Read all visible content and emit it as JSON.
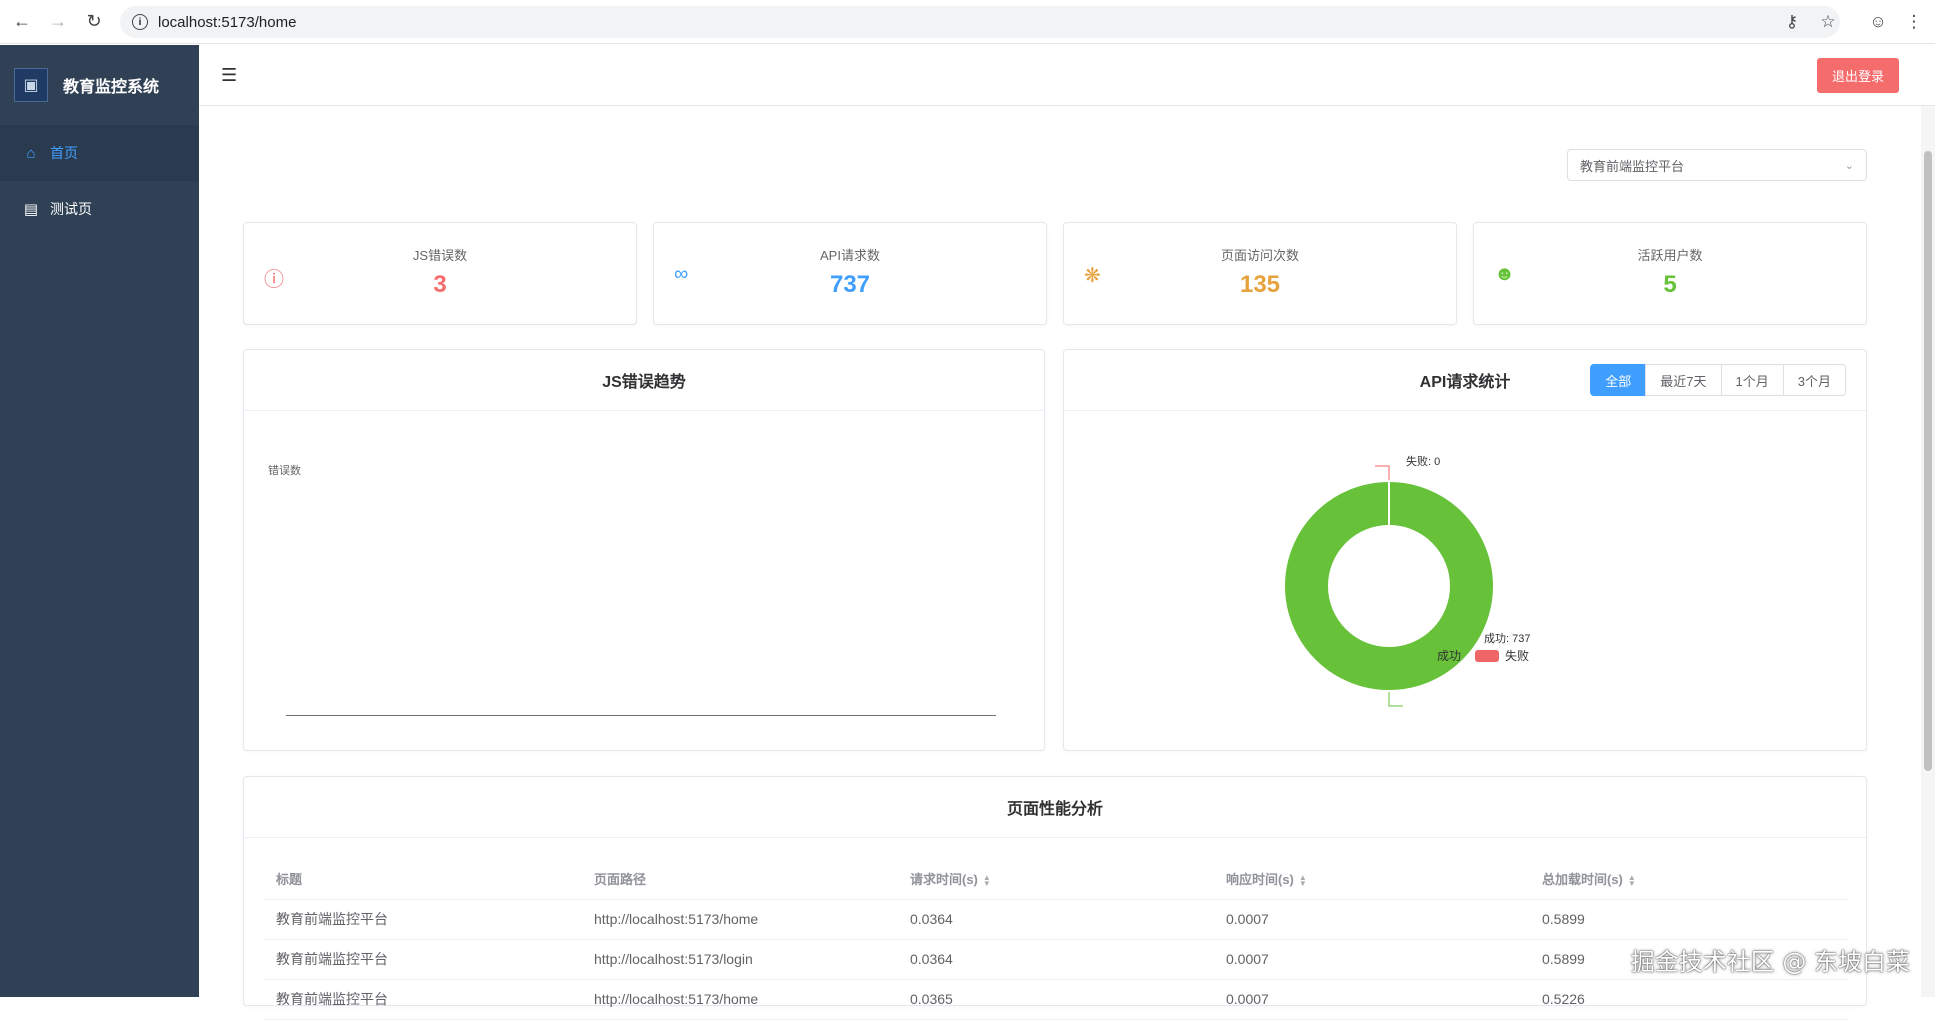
{
  "browser": {
    "url": "localhost:5173/home"
  },
  "sidebar": {
    "title": "教育监控系统",
    "items": [
      {
        "label": "首页",
        "icon": "home-icon",
        "active": true
      },
      {
        "label": "测试页",
        "icon": "monitor-icon",
        "active": false
      }
    ]
  },
  "header": {
    "logout_label": "退出登录"
  },
  "project_select": {
    "value": "教育前端监控平台"
  },
  "stats": [
    {
      "label": "JS错误数",
      "value": "3",
      "color": "#f56c6c",
      "icon": "warning-circle-icon"
    },
    {
      "label": "API请求数",
      "value": "737",
      "color": "#409eff",
      "icon": "link-icon"
    },
    {
      "label": "页面访问次数",
      "value": "135",
      "color": "#e6a23c",
      "icon": "loading-icon"
    },
    {
      "label": "活跃用户数",
      "value": "5",
      "color": "#67c23a",
      "icon": "user-icon"
    }
  ],
  "js_error_panel": {
    "title": "JS错误趋势",
    "ylabel": "错误数"
  },
  "api_panel": {
    "title": "API请求统计",
    "ranges": [
      "全部",
      "最近7天",
      "1个月",
      "3个月"
    ],
    "active_range": "全部"
  },
  "chart_data": {
    "type": "pie",
    "categories": [
      "成功",
      "失败"
    ],
    "values": [
      737,
      0
    ],
    "colors": [
      "#67c23a",
      "#ee6666"
    ],
    "labels": [
      "成功: 737",
      "失败: 0"
    ],
    "legend": "bottom"
  },
  "perf_panel": {
    "title": "页面性能分析",
    "columns": [
      "标题",
      "页面路径",
      "请求时间(s)",
      "响应时间(s)",
      "总加载时间(s)"
    ],
    "rows": [
      [
        "教育前端监控平台",
        "http://localhost:5173/home",
        "0.0364",
        "0.0007",
        "0.5899"
      ],
      [
        "教育前端监控平台",
        "http://localhost:5173/login",
        "0.0364",
        "0.0007",
        "0.5899"
      ],
      [
        "教育前端监控平台",
        "http://localhost:5173/home",
        "0.0365",
        "0.0007",
        "0.5226"
      ]
    ]
  },
  "watermark": "掘金技术社区 @ 东坡白菜"
}
